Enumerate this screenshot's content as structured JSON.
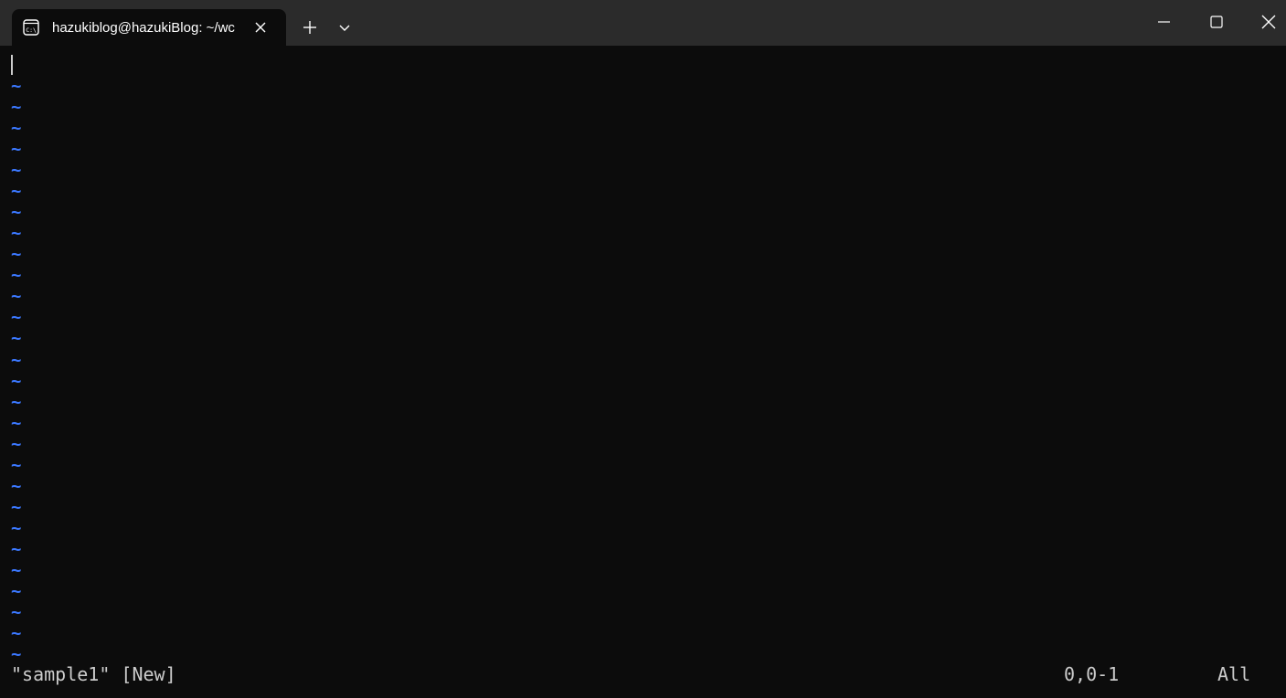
{
  "window": {
    "tab_title": "hazukiblog@hazukiBlog: ~/wc",
    "tab_icon": "terminal-icon",
    "colors": {
      "titlebar": "#2b2b2b",
      "background": "#0c0c0c",
      "tilde": "#3b78ff",
      "text": "#cccccc"
    }
  },
  "editor": {
    "empty_line_marker": "~",
    "empty_line_count": 28
  },
  "statusline": {
    "message": "\"sample1\" [New]",
    "position": "0,0-1",
    "scroll": "All"
  }
}
